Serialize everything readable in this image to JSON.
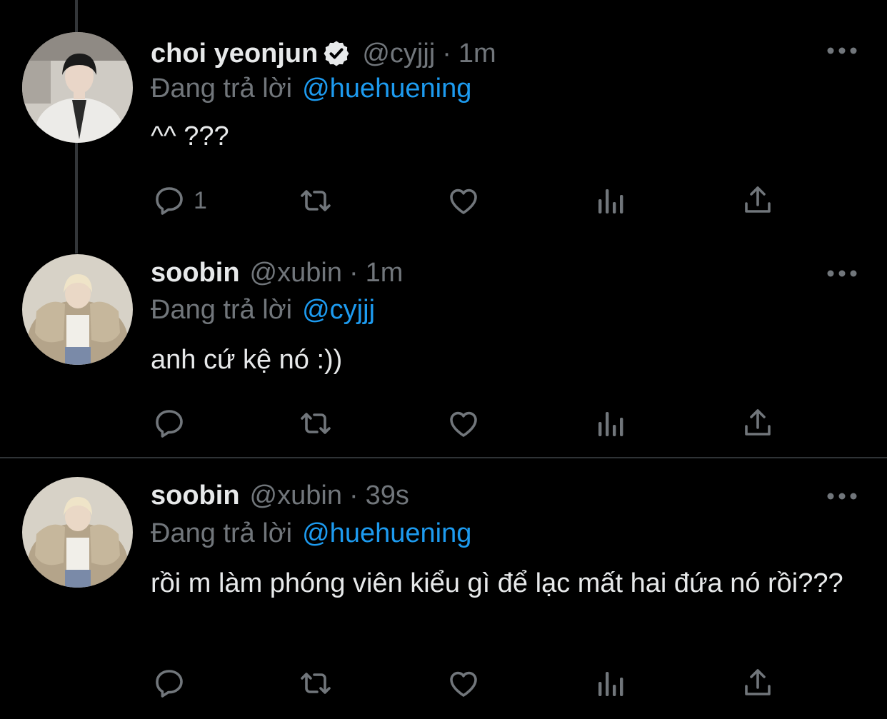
{
  "colors": {
    "background": "#000000",
    "text": "#e7e9ea",
    "secondary": "#71767b",
    "link": "#1d9bf0",
    "divider": "#2f3336"
  },
  "tweets": [
    {
      "name": "choi yeonjun",
      "verified": true,
      "handle": "@cyjjj",
      "separator": "·",
      "time": "1m",
      "replying_label": "Đang trả lời",
      "replying_to": "@huehuening",
      "text": "^^ ???",
      "reply_count": "1",
      "icons": [
        "reply-icon",
        "retweet-icon",
        "like-icon",
        "views-icon",
        "share-icon",
        "more-icon"
      ]
    },
    {
      "name": "soobin",
      "verified": false,
      "handle": "@xubin",
      "separator": "·",
      "time": "1m",
      "replying_label": "Đang trả lời",
      "replying_to": "@cyjjj",
      "text": "anh cứ kệ nó :))",
      "reply_count": "",
      "icons": [
        "reply-icon",
        "retweet-icon",
        "like-icon",
        "views-icon",
        "share-icon",
        "more-icon"
      ]
    },
    {
      "name": "soobin",
      "verified": false,
      "handle": "@xubin",
      "separator": "·",
      "time": "39s",
      "replying_label": "Đang trả lời",
      "replying_to": "@huehuening",
      "text": "rồi m làm phóng viên kiểu gì để lạc mất hai đứa nó rồi???",
      "reply_count": "",
      "icons": [
        "reply-icon",
        "retweet-icon",
        "like-icon",
        "views-icon",
        "share-icon",
        "more-icon"
      ]
    }
  ]
}
